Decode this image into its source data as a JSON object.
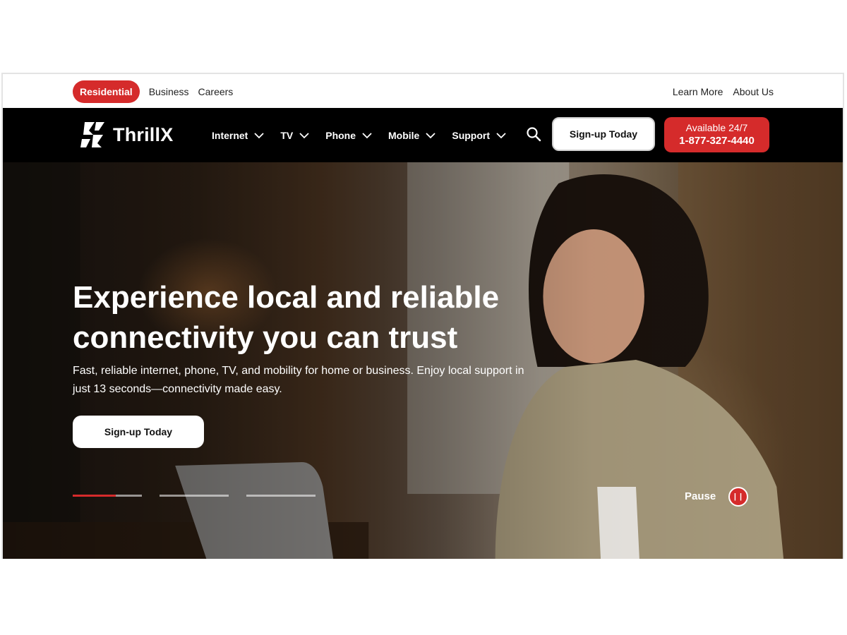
{
  "utility_nav": {
    "left": [
      "Residential",
      "Business",
      "Careers"
    ],
    "right": [
      "Learn More",
      "About Us"
    ]
  },
  "brand": {
    "name": "ThrillX"
  },
  "main_nav": {
    "items": [
      "Internet",
      "TV",
      "Phone",
      "Mobile",
      "Support"
    ],
    "signup_label": "Sign-up Today",
    "phone_cta": {
      "line1": "Available 24/7",
      "line2": "1-877-327-4440"
    }
  },
  "hero": {
    "title": "Experience local and reliable connectivity you can trust",
    "subtitle": "Fast, reliable internet, phone, TV, and mobility for home or business. Enjoy local support in just 13 seconds—connectivity made easy.",
    "cta_label": "Sign-up Today",
    "slides": [
      {
        "progress": 0.62
      },
      {
        "progress": 0
      },
      {
        "progress": 0
      }
    ],
    "pause_label": "Pause",
    "pause_icon": "pause-icon"
  },
  "colors": {
    "accent": "#d52b2b",
    "navbar": "#000000"
  }
}
